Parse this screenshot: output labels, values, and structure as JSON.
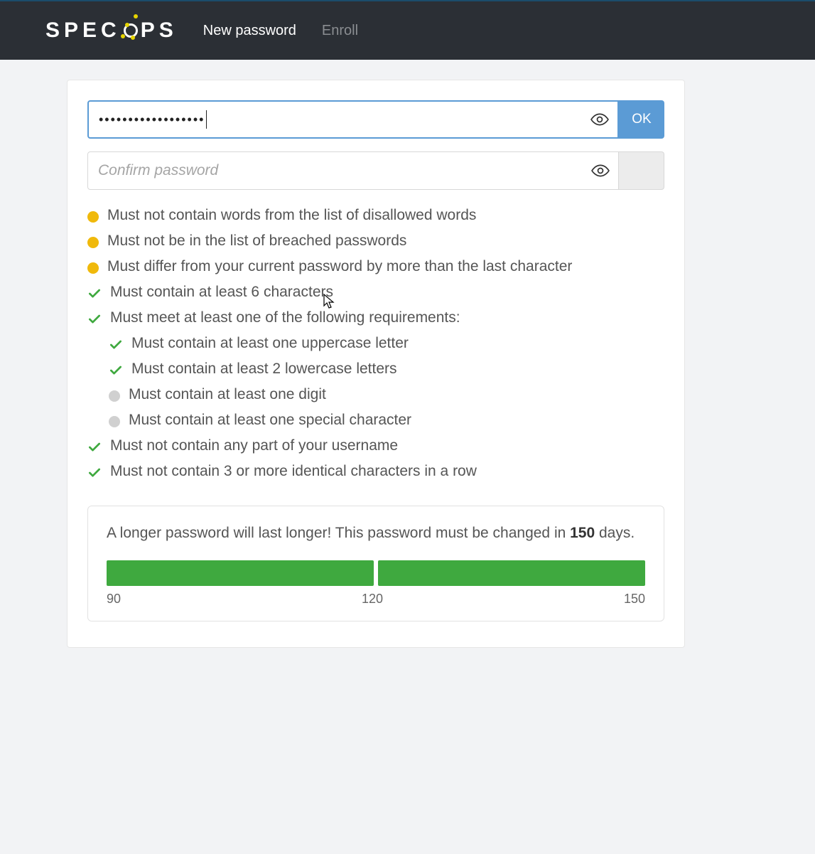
{
  "header": {
    "brand_letters": [
      "S",
      "P",
      "E",
      "C",
      "O",
      "P",
      "S"
    ],
    "nav": [
      {
        "label": "New password",
        "active": true
      },
      {
        "label": "Enroll",
        "active": false
      }
    ]
  },
  "form": {
    "password_value_masked": "••••••••••••••••••",
    "ok_label": "OK",
    "confirm_placeholder": "Confirm password"
  },
  "rules": [
    {
      "status": "pending",
      "text": "Must not contain words from the list of disallowed words",
      "sub": false
    },
    {
      "status": "pending",
      "text": "Must not be in the list of breached passwords",
      "sub": false
    },
    {
      "status": "pending",
      "text": "Must differ from your current password by more than the last character",
      "sub": false
    },
    {
      "status": "pass",
      "text": "Must contain at least 6 characters",
      "sub": false
    },
    {
      "status": "pass",
      "text": "Must meet at least one of the following requirements:",
      "sub": false
    },
    {
      "status": "pass",
      "text": "Must contain at least one uppercase letter",
      "sub": true
    },
    {
      "status": "pass",
      "text": "Must contain at least 2 lowercase letters",
      "sub": true
    },
    {
      "status": "neutral",
      "text": "Must contain at least one digit",
      "sub": true
    },
    {
      "status": "neutral",
      "text": "Must contain at least one special character",
      "sub": true
    },
    {
      "status": "pass",
      "text": "Must not contain any part of your username",
      "sub": false
    },
    {
      "status": "pass",
      "text": "Must not contain 3 or more identical characters in a row",
      "sub": false
    }
  ],
  "expiry": {
    "prefix": "A longer password will last longer! This password must be changed in ",
    "days": "150",
    "suffix": " days.",
    "ticks": [
      "90",
      "120",
      "150"
    ]
  }
}
